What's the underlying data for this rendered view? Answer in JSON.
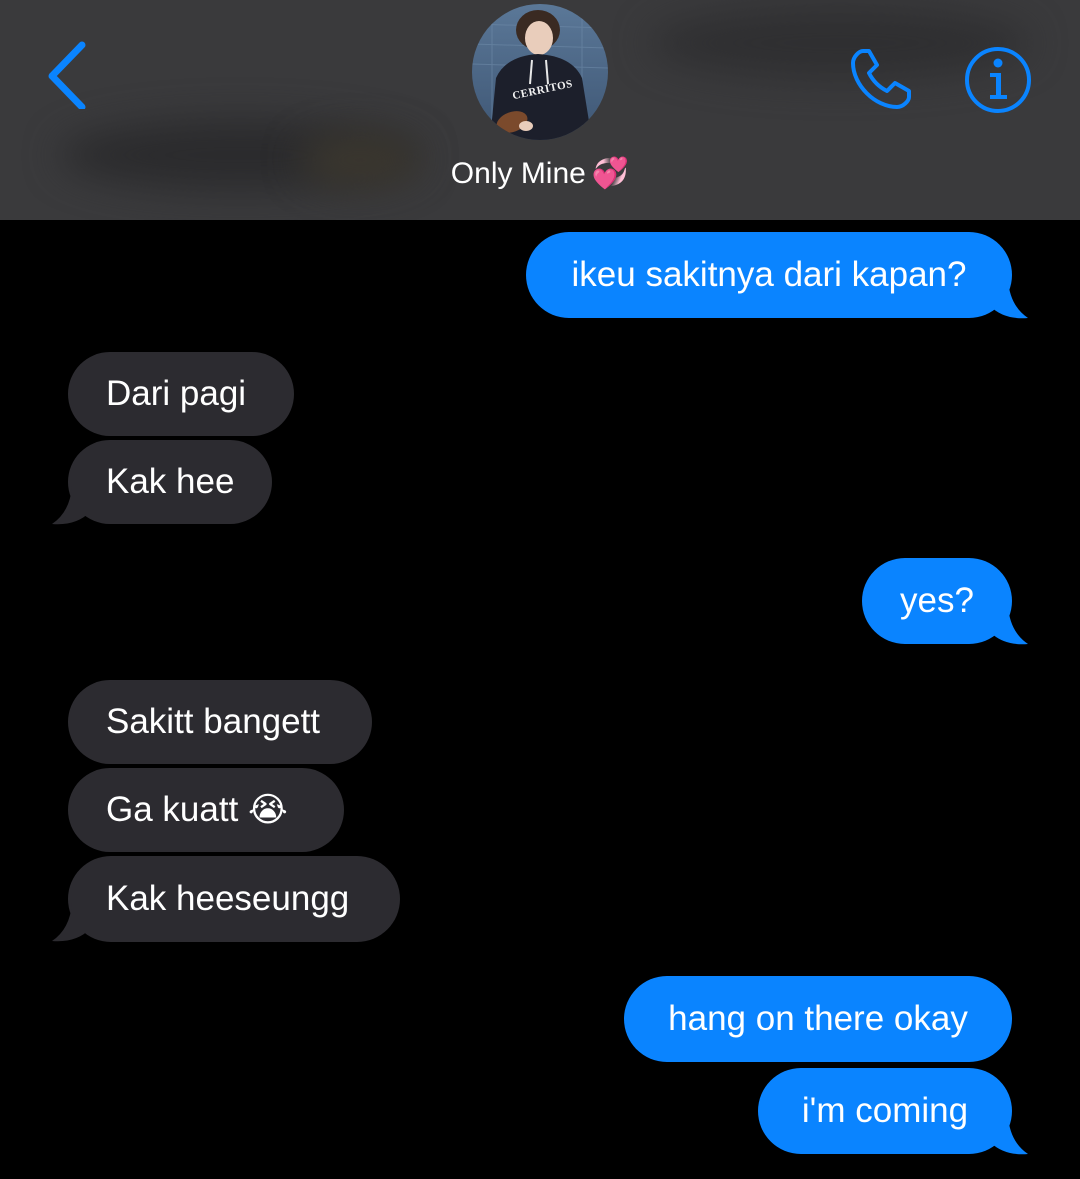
{
  "header": {
    "contact_name": "Only Mine",
    "contact_emoji": "💞",
    "back_icon": "chevron-left-icon",
    "call_icon": "phone-icon",
    "info_icon": "info-icon",
    "avatar_text": "CERRITOS",
    "accent_color": "#0a84ff"
  },
  "messages": [
    {
      "direction": "outgoing",
      "text": "ikeu sakitnya dari kapan?"
    },
    {
      "direction": "incoming",
      "text": "Dari pagi"
    },
    {
      "direction": "incoming",
      "text": "Kak hee"
    },
    {
      "direction": "outgoing",
      "text": "yes?"
    },
    {
      "direction": "incoming",
      "text": "Sakitt bangett"
    },
    {
      "direction": "incoming",
      "text": "Ga kuatt",
      "emoji": "😭"
    },
    {
      "direction": "incoming",
      "text": "Kak heeseungg"
    },
    {
      "direction": "outgoing",
      "text": "hang on there okay"
    },
    {
      "direction": "outgoing",
      "text": "i'm coming"
    }
  ],
  "colors": {
    "outgoing_bubble": "#0a84ff",
    "incoming_bubble": "#2c2b30",
    "header_bg": "#3a3a3c",
    "background": "#000000"
  }
}
